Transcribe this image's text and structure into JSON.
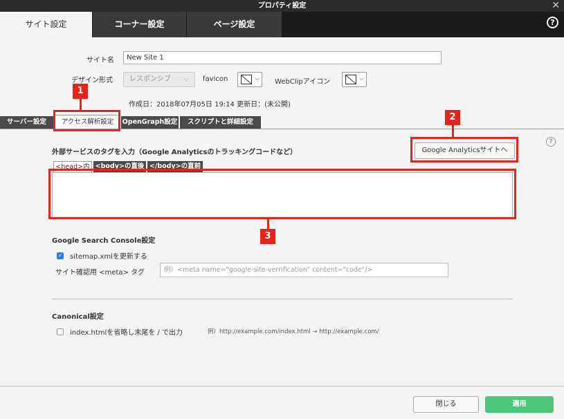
{
  "window": {
    "title": "プロパティ設定"
  },
  "main_tabs": [
    {
      "label": "サイト設定",
      "active": true
    },
    {
      "label": "コーナー設定",
      "active": false
    },
    {
      "label": "ページ設定",
      "active": false
    }
  ],
  "site": {
    "name_label": "サイト名",
    "name_value": "New Site 1",
    "design_label": "デザイン形式",
    "design_value": "レスポンシブ",
    "favicon_label": "favicon",
    "webclip_label": "WebClipアイコン",
    "date_info": "作成日：2018年07月05日 19:14 更新日：(未公開)"
  },
  "sub_tabs": [
    {
      "label": "サーバー設定",
      "active": false
    },
    {
      "label": "アクセス解析設定",
      "active": true
    },
    {
      "label": "OpenGraph設定",
      "active": false
    },
    {
      "label": "スクリプトと詳細設定",
      "active": false
    }
  ],
  "access": {
    "external_label": "外部サービスのタグを入力（Google Analyticsのトラッキングコードなど）",
    "ga_button": "Google Analyticsサイトへ",
    "code_tabs": [
      {
        "label": "<head>内",
        "active": true
      },
      {
        "label": "<body>の直後",
        "active": false
      },
      {
        "label": "</body>の直前",
        "active": false
      }
    ],
    "code_value": ""
  },
  "search_console": {
    "heading": "Google Search Console設定",
    "sitemap_label": "sitemap.xmlを更新する",
    "sitemap_checked": true,
    "meta_label": "サイト確認用 <meta> タグ",
    "meta_placeholder": "例）<meta name=\"google-site-verrification\" content=\"code\"/>"
  },
  "canonical": {
    "heading": "Canonical設定",
    "index_label": "index.htmlを省略し末尾を / で出力",
    "index_checked": false,
    "example": "例）http://example.com/index.html → http://example.com/"
  },
  "footer": {
    "close_label": "閉じる",
    "apply_label": "適用"
  },
  "annotations": [
    "1",
    "2",
    "3"
  ],
  "colors": {
    "accent": "#e8231c",
    "apply": "#4cc77a",
    "checkbox": "#2d7be5",
    "dark": "#2b2b2b"
  },
  "icons": [
    "close-icon",
    "help-icon",
    "favicon-placeholder-icon",
    "webclip-placeholder-icon",
    "chevron-down-icon",
    "checkmark-icon"
  ]
}
